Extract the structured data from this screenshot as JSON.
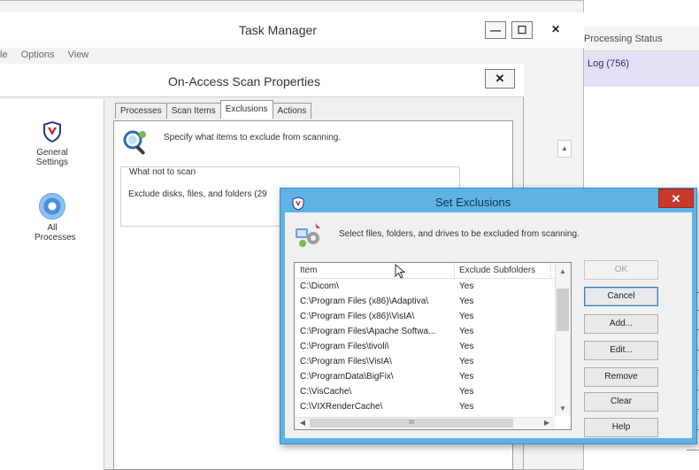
{
  "background": {
    "header_label": "Processing Status",
    "tab_label": "Log (756)"
  },
  "task_manager": {
    "title": "Task Manager",
    "menu": [
      "le",
      "Options",
      "View"
    ],
    "minimize_label": "—",
    "maximize_label": "☐",
    "close_label": "✕"
  },
  "oas": {
    "title": "On-Access Scan Properties",
    "close_label": "✕",
    "nav": [
      {
        "label": "General Settings",
        "icon": "shield-icon"
      },
      {
        "label": "All Processes",
        "icon": "disc-icon"
      }
    ],
    "tabs": [
      "Processes",
      "Scan Items",
      "Exclusions",
      "Actions"
    ],
    "active_tab": "Exclusions",
    "description": "Specify what items to exclude from scanning.",
    "group_label": "What not to scan",
    "group_text": "Exclude disks, files, and folders (29"
  },
  "set_exclusions": {
    "title": "Set Exclusions",
    "close_label": "✕",
    "description": "Select files, folders, and drives to be excluded from scanning.",
    "columns": [
      "Item",
      "Exclude Subfolders"
    ],
    "rows": [
      {
        "item": "C:\\Dicom\\",
        "sub": "Yes"
      },
      {
        "item": "C:\\Program Files (x86)\\Adaptiva\\",
        "sub": "Yes"
      },
      {
        "item": "C:\\Program Files (x86)\\VisIA\\",
        "sub": "Yes"
      },
      {
        "item": "C:\\Program Files\\Apache Softwa...",
        "sub": "Yes"
      },
      {
        "item": "C:\\Program Files\\tivoli\\",
        "sub": "Yes"
      },
      {
        "item": "C:\\Program Files\\VisIA\\",
        "sub": "Yes"
      },
      {
        "item": "C:\\ProgramData\\BigFix\\",
        "sub": "Yes"
      },
      {
        "item": "C:\\VisCache\\",
        "sub": "Yes"
      },
      {
        "item": "C:\\VIXRenderCache\\",
        "sub": "Yes"
      }
    ],
    "hscroll_grip": "III",
    "buttons": [
      {
        "label": "OK",
        "enabled": false
      },
      {
        "label": "Cancel",
        "enabled": true
      },
      {
        "label": "Add...",
        "enabled": true
      },
      {
        "label": "Edit...",
        "enabled": true
      },
      {
        "label": "Remove",
        "enabled": true
      },
      {
        "label": "Clear",
        "enabled": true
      },
      {
        "label": "Help",
        "enabled": true
      }
    ]
  },
  "colors": {
    "dialog_frame": "#5fb3e4",
    "close_red": "#c9382d",
    "log_tab": "#e3e0f5"
  }
}
